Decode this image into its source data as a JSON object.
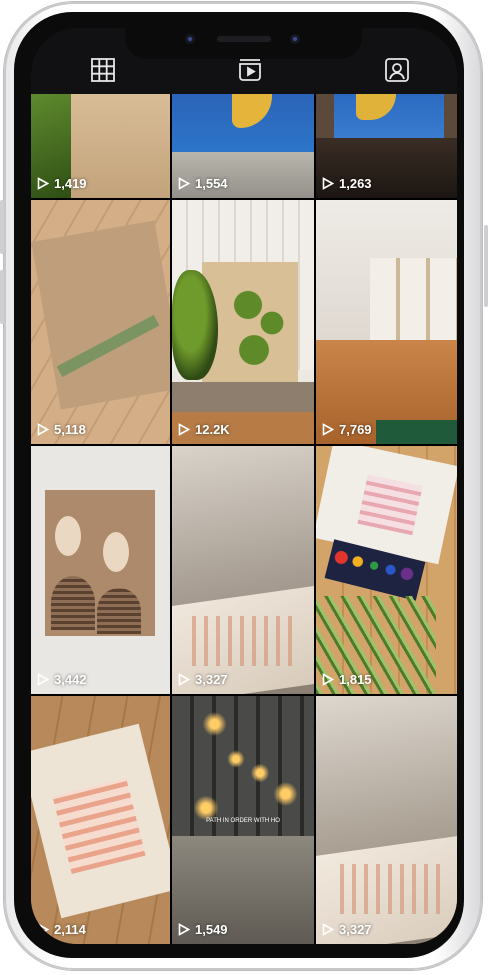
{
  "tabs": [
    {
      "name": "grid-icon",
      "active": false
    },
    {
      "name": "reels-icon",
      "active": true
    },
    {
      "name": "tagged-icon",
      "active": false
    }
  ],
  "reels": [
    {
      "views": "1,419"
    },
    {
      "views": "1,554"
    },
    {
      "views": "1,263"
    },
    {
      "views": "5,118"
    },
    {
      "views": "12.2K"
    },
    {
      "views": "7,769"
    },
    {
      "views": "3,442"
    },
    {
      "views": "3,327"
    },
    {
      "views": "1,815"
    },
    {
      "views": "2,114"
    },
    {
      "views": "1,549",
      "overlay_text": "PATH IN ORDER WITH HO"
    },
    {
      "views": "3,327"
    }
  ],
  "colors": {
    "top_bar": "#111113",
    "icon": "#e6e6e6"
  }
}
